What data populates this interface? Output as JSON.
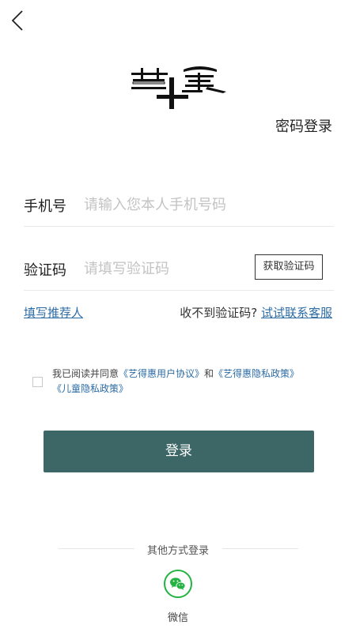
{
  "nav": {
    "back_icon": "chevron-left-icon"
  },
  "logo": {
    "name": "brand-logo"
  },
  "header": {
    "password_login": "密码登录"
  },
  "phone": {
    "label": "手机号",
    "placeholder": "请输入您本人手机号码",
    "value": ""
  },
  "code": {
    "label": "验证码",
    "placeholder": "请填写验证码",
    "value": "",
    "get_code": "获取验证码"
  },
  "referrer": {
    "label": "填写推荐人"
  },
  "help": {
    "no_code": "收不到验证码?",
    "contact": "试试联系客服"
  },
  "agreement": {
    "prefix": "我已阅读并同意",
    "user_agreement": "《艺得惠用户协议》",
    "and": "和",
    "privacy_policy": "《艺得惠隐私政策》",
    "child_policy": "《儿童隐私政策》",
    "checked": false
  },
  "login_button": "登录",
  "other_login": {
    "label": "其他方式登录",
    "wechat": "微信",
    "wechat_icon": "wechat-icon"
  },
  "colors": {
    "primary": "#3d6767",
    "link": "#2c6ca6",
    "wechat": "#24b343"
  }
}
